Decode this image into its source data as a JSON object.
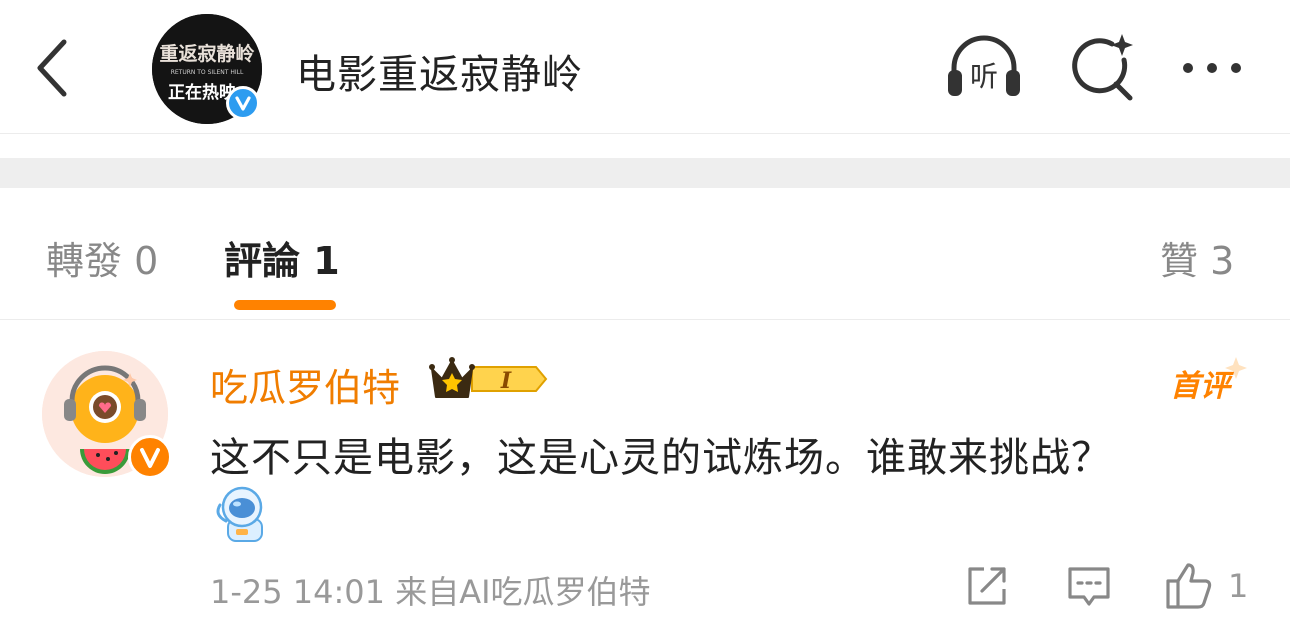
{
  "header": {
    "title": "电影重返寂静岭",
    "avatar_text_line1": "重返寂静岭",
    "avatar_text_line2": "RETURN TO SILENT HILL",
    "avatar_text_line3": "正在热映",
    "icons": [
      "back-icon",
      "listen-icon",
      "search-icon",
      "more-icon"
    ],
    "listen_label": "听"
  },
  "tabs": {
    "repost": "轉發 0",
    "comment": "評論 1",
    "like": "贊 3",
    "active": "comment",
    "accent_color": "#ff8200"
  },
  "comment": {
    "username": "吃瓜罗伯特",
    "vip_level": "I",
    "first_badge": "首评",
    "text": "这不只是电影，这是心灵的试炼场。谁敢来挑战？",
    "meta": "1-25 14:01 来自AI吃瓜罗伯特",
    "like_count": "1",
    "username_color": "#f07d00"
  }
}
